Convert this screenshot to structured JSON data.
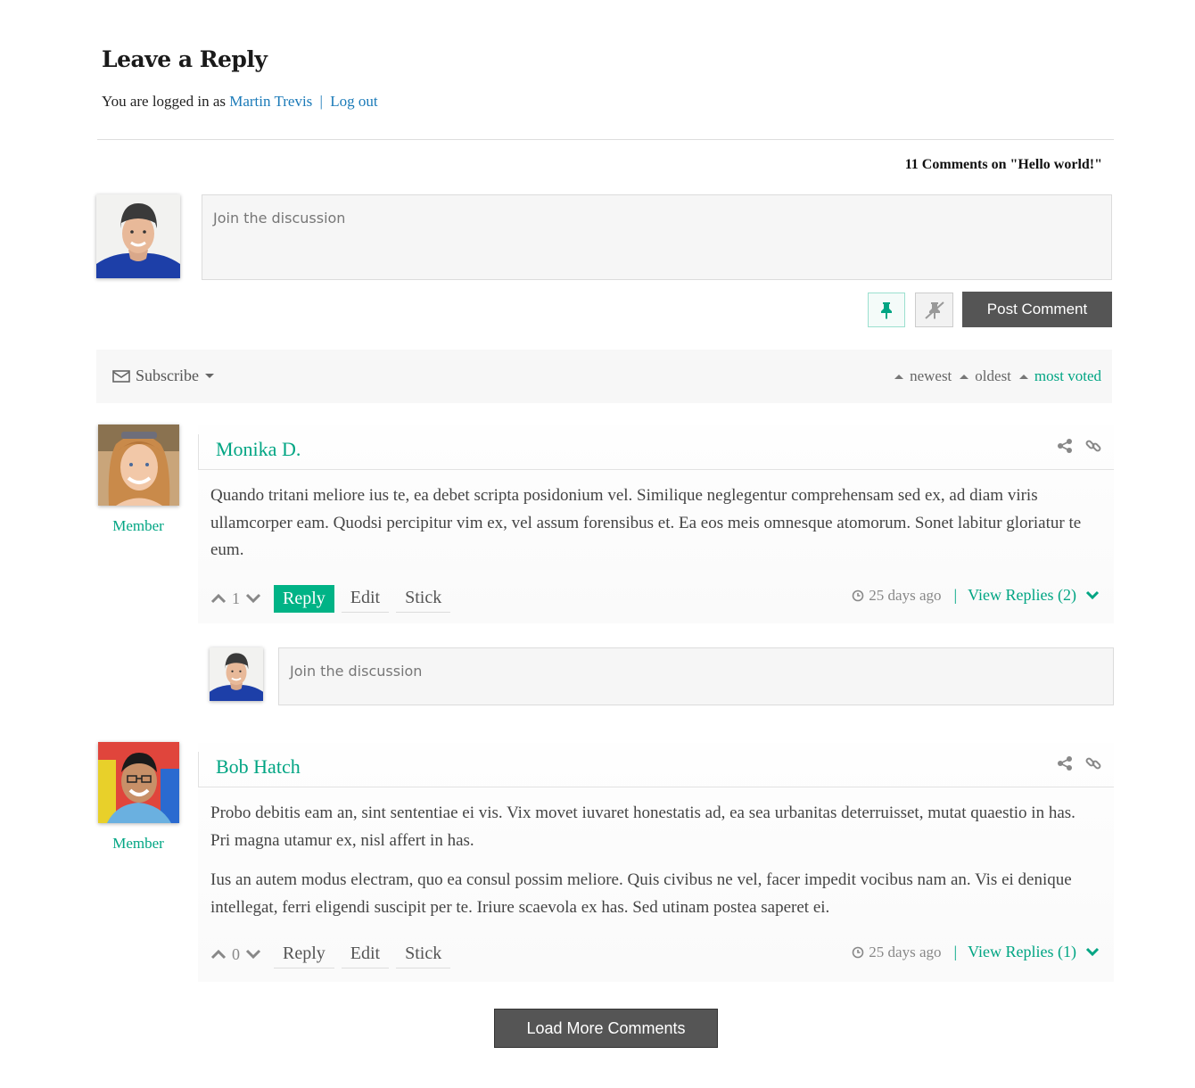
{
  "reply_form": {
    "title": "Leave a Reply",
    "logged_in_prefix": "You are logged in as",
    "user_name": "Martin Trevis",
    "separator": "|",
    "logout": "Log out",
    "comments_count": "11 Comments on \"Hello world!\"",
    "placeholder": "Join the discussion",
    "post_button": "Post Comment"
  },
  "toolbar": {
    "subscribe": "Subscribe",
    "sorts": [
      {
        "label": "newest",
        "active": false
      },
      {
        "label": "oldest",
        "active": false
      },
      {
        "label": "most voted",
        "active": true
      }
    ]
  },
  "comments": [
    {
      "author": "Monika D.",
      "role": "Member",
      "paragraphs": [
        "Quando tritani meliore ius te, ea debet scripta posidonium vel. Similique neglegentur comprehensam sed ex, ad diam viris ullamcorper eam. Quodsi percipitur vim ex, vel assum forensibus et. Ea eos meis omnesque atomorum. Sonet labitur gloriatur te eum."
      ],
      "votes": "1",
      "reply": "Reply",
      "edit": "Edit",
      "stick": "Stick",
      "time": "25 days ago",
      "view_replies": "View Replies (2)"
    },
    {
      "author": "Bob Hatch",
      "role": "Member",
      "paragraphs": [
        "Probo debitis eam an, sint sententiae ei vis. Vix movet iuvaret honestatis ad, ea sea urbanitas deterruisset, mutat quaestio in has. Pri magna utamur ex, nisl affert in has.",
        "Ius an autem modus electram, quo ea consul possim meliore. Quis civibus ne vel, facer impedit vocibus nam an. Vis ei denique intellegat, ferri eligendi suscipit per te. Iriure scaevola ex has. Sed utinam postea saperet ei."
      ],
      "votes": "0",
      "reply": "Reply",
      "edit": "Edit",
      "stick": "Stick",
      "time": "25 days ago",
      "view_replies": "View Replies (1)"
    }
  ],
  "reply_box": {
    "placeholder": "Join the discussion"
  },
  "load_more": "Load More Comments",
  "colors": {
    "accent": "#00a583",
    "link": "#1a7ab8",
    "dark_button": "#555555"
  }
}
